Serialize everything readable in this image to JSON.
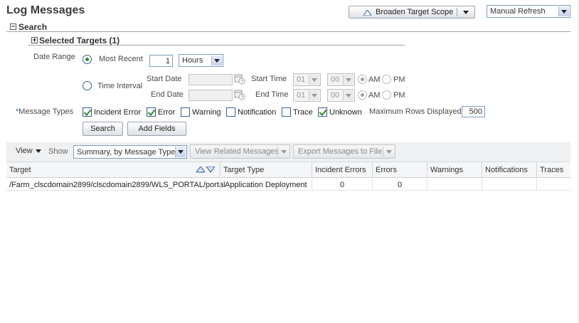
{
  "page": {
    "title": "Log Messages"
  },
  "header": {
    "broaden_label": "Broaden Target Scope",
    "refresh_value": "Manual Refresh"
  },
  "search": {
    "section_label": "Search",
    "selected_targets_label": "Selected Targets (1)",
    "date_range_label": "Date Range",
    "most_recent_label": "Most Recent",
    "most_recent_value": "1",
    "most_recent_unit": "Hours",
    "time_interval_label": "Time Interval",
    "start_date_label": "Start Date",
    "end_date_label": "End Date",
    "start_time_label": "Start Time",
    "end_time_label": "End Time",
    "start_hour": "01",
    "start_minute": "00",
    "end_hour": "01",
    "end_minute": "00",
    "am_label": "AM",
    "pm_label": "PM",
    "required_mark": "*",
    "message_types_label": "Message Types",
    "types": [
      {
        "label": "Incident Error",
        "checked": true
      },
      {
        "label": "Error",
        "checked": true
      },
      {
        "label": "Warning",
        "checked": false
      },
      {
        "label": "Notification",
        "checked": false
      },
      {
        "label": "Trace",
        "checked": false
      },
      {
        "label": "Unknown",
        "checked": true
      }
    ],
    "max_rows_label": "Maximum Rows Displayed",
    "max_rows_value": "500",
    "search_button": "Search",
    "add_fields_button": "Add Fields"
  },
  "toolbar": {
    "view_label": "View",
    "show_label": "Show",
    "show_value": "Summary, by Message Type",
    "view_related_label": "View Related Messages",
    "export_label": "Export Messages to File"
  },
  "table": {
    "columns": [
      "Target",
      "Target Type",
      "Incident Errors",
      "Errors",
      "Warnings",
      "Notifications",
      "Traces"
    ],
    "rows": [
      {
        "target": "/Farm_clscdomain2899/clscdomain2899/WLS_PORTAL/portal",
        "target_type": "Application Deployment",
        "incident_errors": "0",
        "errors": "0",
        "warnings": "",
        "notifications": "",
        "traces": ""
      }
    ]
  }
}
